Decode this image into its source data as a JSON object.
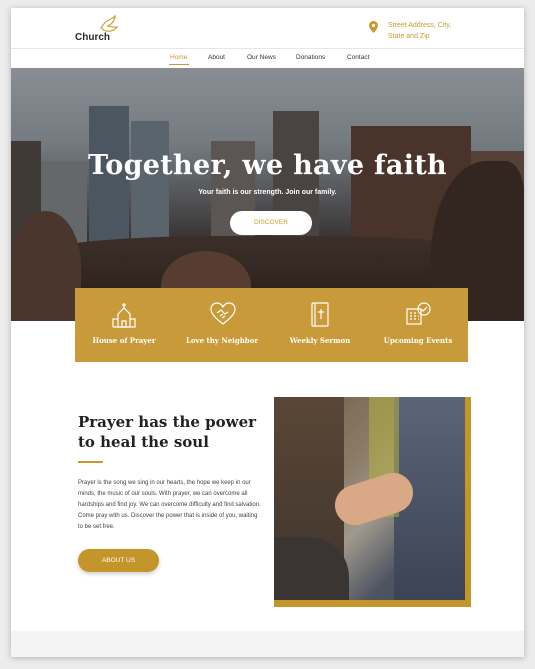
{
  "header": {
    "logo_text": "Church",
    "address_line1": "Street Address, City,",
    "address_line2": "State and Zip"
  },
  "nav": {
    "items": [
      "Home",
      "About",
      "Our News",
      "Donations",
      "Contact"
    ],
    "active": "Home"
  },
  "hero": {
    "title": "Together, we have faith",
    "subtitle": "Your faith is our strength. Join our family.",
    "button": "DISCOVER"
  },
  "features": [
    {
      "label": "House of Prayer",
      "icon": "church-icon"
    },
    {
      "label": "Love thy Neighbor",
      "icon": "heart-handshake-icon"
    },
    {
      "label": "Weekly Sermon",
      "icon": "bible-icon"
    },
    {
      "label": "Upcoming Events",
      "icon": "calendar-check-icon"
    }
  ],
  "prayer": {
    "title": "Prayer has the power to heal the soul",
    "body": "Prayer is the song we sing in our hearts, the hope we keep in our minds, the music of our souls. With prayer, we can overcome all hardships and find joy. We can overcome difficulty and find salvation. Come pray with us. Discover the power that is inside of you, waiting to be set free.",
    "button": "ABOUT US"
  },
  "colors": {
    "accent": "#c99a2e",
    "band": "#c99a3a"
  }
}
